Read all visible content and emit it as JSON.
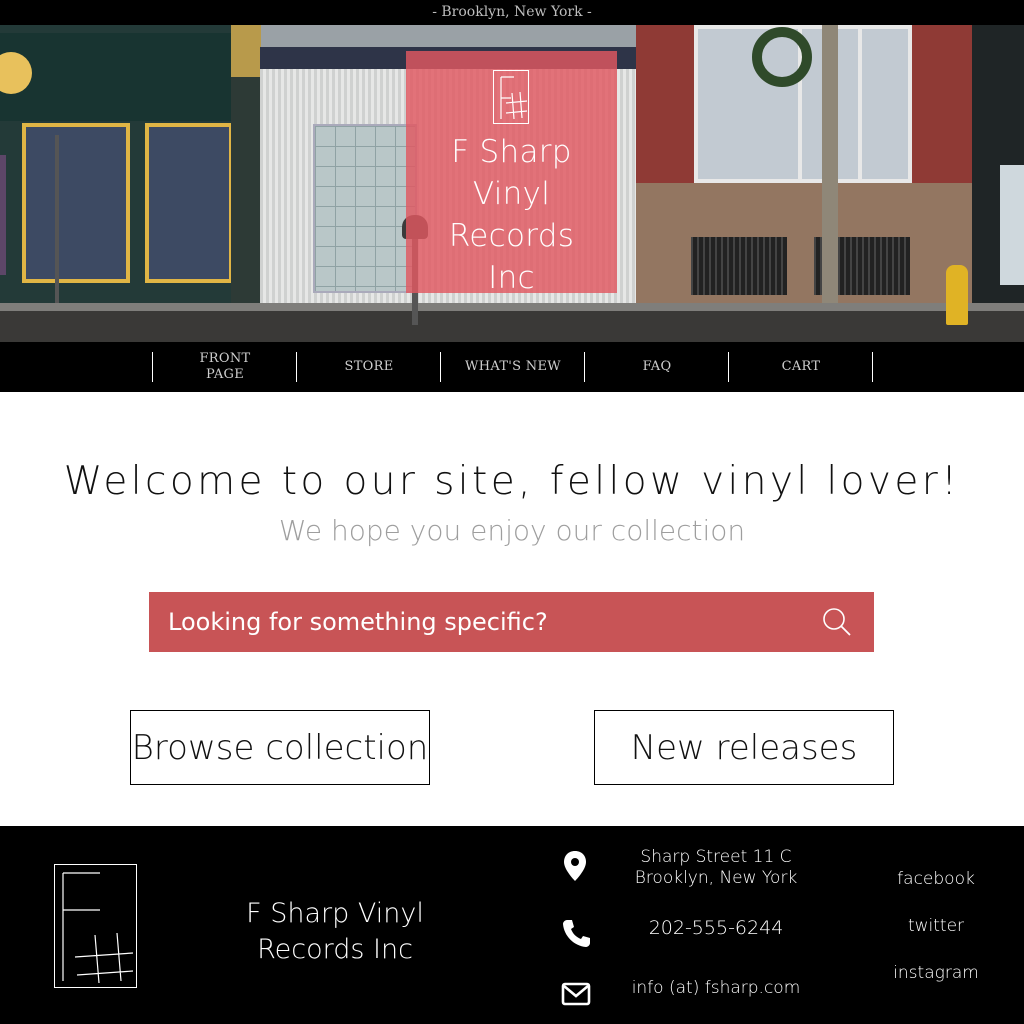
{
  "topbar": {
    "location": "- Brooklyn, New York -"
  },
  "brand": {
    "name_lines": [
      "F Sharp",
      "Vinyl",
      "Records",
      "Inc"
    ]
  },
  "nav": {
    "items": [
      {
        "label": "FRONT PAGE"
      },
      {
        "label": "STORE"
      },
      {
        "label": "WHAT'S NEW"
      },
      {
        "label": "FAQ"
      },
      {
        "label": "CART"
      }
    ]
  },
  "main": {
    "heading": "Welcome to our site, fellow vinyl lover!",
    "subheading": "We hope you enjoy our collection",
    "search": {
      "placeholder": "Looking for something specific?",
      "icon": "search-icon"
    },
    "buttons": {
      "browse": "Browse collection",
      "new_releases": "New releases"
    }
  },
  "footer": {
    "name": "F Sharp Vinyl Records Inc",
    "address_line1": "Sharp Street 11 C",
    "address_line2": "Brooklyn, New York",
    "phone": "202-555-6244",
    "email": "info (at) fsharp.com",
    "social": {
      "facebook": "facebook",
      "twitter": "twitter",
      "instagram": "instagram"
    }
  },
  "colors": {
    "accent": "#c85456",
    "brand_overlay": "#e15860",
    "background_dark": "#000000"
  }
}
